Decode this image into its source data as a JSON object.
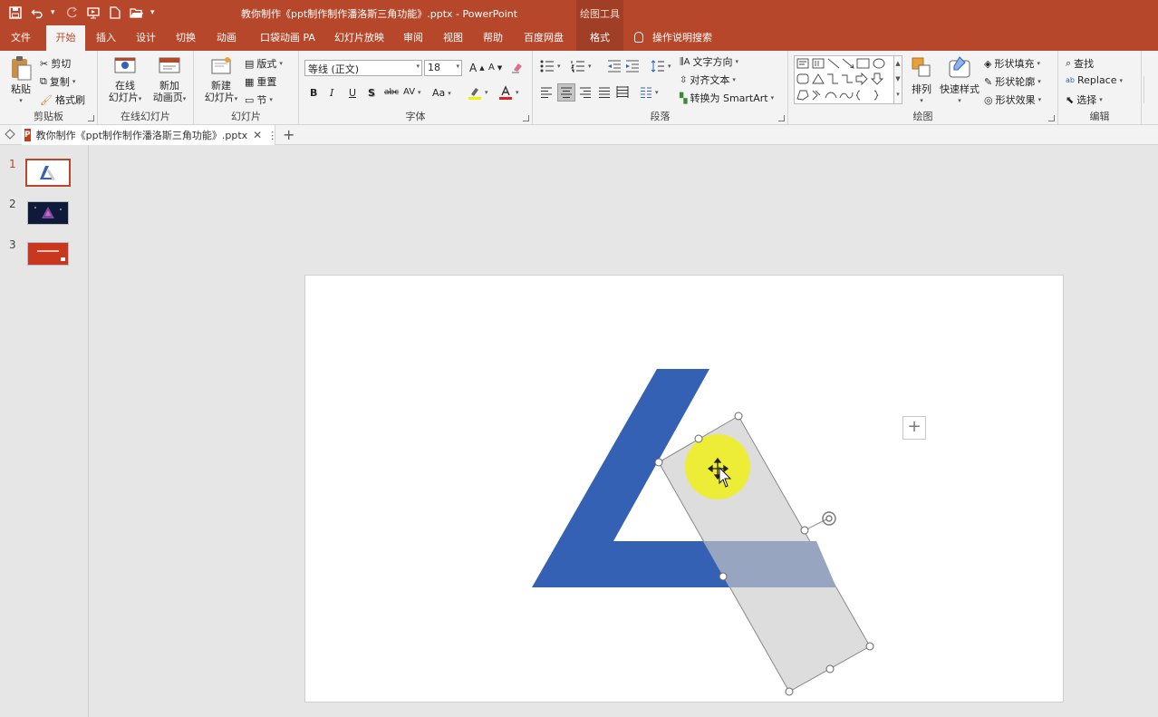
{
  "window": {
    "title": "教你制作《ppt制作制作潘洛斯三角功能》.pptx - PowerPoint",
    "tools_title": "绘图工具"
  },
  "tabs": [
    {
      "label": "文件"
    },
    {
      "label": "开始"
    },
    {
      "label": "插入"
    },
    {
      "label": "设计"
    },
    {
      "label": "切换"
    },
    {
      "label": "动画"
    },
    {
      "label": "口袋动画 PA"
    },
    {
      "label": "幻灯片放映"
    },
    {
      "label": "审阅"
    },
    {
      "label": "视图"
    },
    {
      "label": "帮助"
    },
    {
      "label": "百度网盘"
    },
    {
      "label": "格式"
    }
  ],
  "tell_me": "操作说明搜索",
  "ribbon": {
    "clipboard": {
      "paste": "粘贴",
      "cut": "剪切",
      "copy": "复制",
      "format_painter": "格式刷",
      "label": "剪贴板"
    },
    "online_slides": {
      "online": "在线",
      "slides": "幻灯片",
      "new": "新加",
      "anim_page": "动画页",
      "label": "在线幻灯片"
    },
    "slides": {
      "new": "新建",
      "slide": "幻灯片",
      "layout": "版式",
      "reset": "重置",
      "section": "节",
      "label": "幻灯片"
    },
    "font": {
      "font_name": "等线 (正文)",
      "font_size": "18",
      "label": "字体",
      "bold": "B",
      "italic": "I",
      "underline": "U",
      "shadow": "S",
      "strike": "abc",
      "spacing": "AV",
      "case": "Aa",
      "grow": "A",
      "shrink": "A"
    },
    "paragraph": {
      "text_direction": "文字方向",
      "align_text": "对齐文本",
      "smartart": "转换为 SmartArt",
      "label": "段落"
    },
    "drawing": {
      "arrange": "排列",
      "quick_styles": "快速样式",
      "fill": "形状填充",
      "outline": "形状轮廓",
      "effects": "形状效果",
      "label": "绘图"
    },
    "editing": {
      "find": "查找",
      "replace": "Replace",
      "select": "选择",
      "label": "编辑"
    }
  },
  "document_tab": {
    "name": "教你制作《ppt制作制作潘洛斯三角功能》.pptx"
  },
  "thumbnails": [
    {
      "num": "1",
      "active": true
    },
    {
      "num": "2",
      "active": false
    },
    {
      "num": "3",
      "active": false
    }
  ],
  "colors": {
    "accent": "#b7472a",
    "shape_blue": "#3461b4",
    "selection_fill": "#d9d9d9",
    "highlight": "#f2f200"
  }
}
